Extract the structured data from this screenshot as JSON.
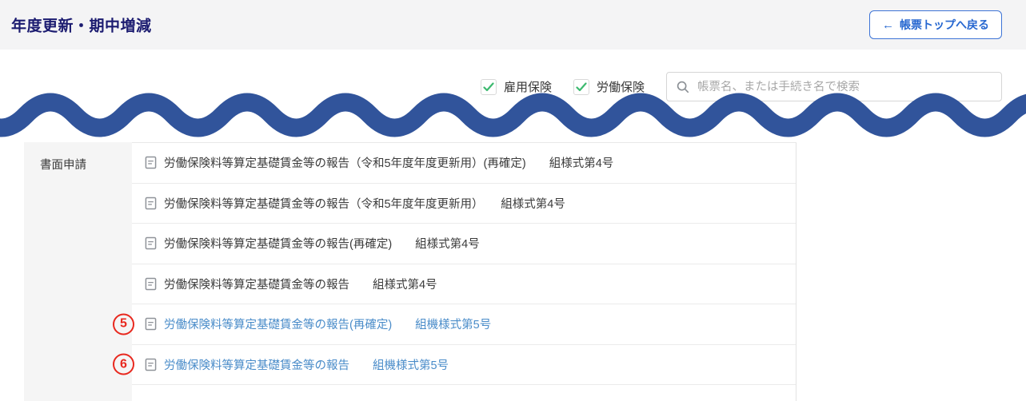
{
  "header": {
    "title": "年度更新・期中増減",
    "back_button_arrow": "←",
    "back_button_label": "帳票トップへ戻る"
  },
  "filters": {
    "checkboxes": [
      {
        "label": "雇用保険",
        "checked": true
      },
      {
        "label": "労働保険",
        "checked": true
      }
    ],
    "search_placeholder": "帳票名、または手続き名で検索"
  },
  "icons": {
    "back": "left-arrow",
    "search": "magnifier",
    "checkbox": "green-checkmark",
    "document": "document-sheet",
    "divider": "torn-edge-wave"
  },
  "colors": {
    "header_bg": "#f4f4f5",
    "title_navy": "#1b1b70",
    "accent_blue": "#2667d0",
    "wave_blue": "#31549b",
    "link_blue": "#4a8cc9",
    "annotation_red": "#e8281e",
    "check_green": "#3cb96f",
    "category_bg": "#f5f5f5"
  },
  "table": {
    "category": "書面申請",
    "rows": [
      {
        "annotation": "",
        "is_link": false,
        "label": "労働保険料等算定基礎賃金等の報告（令和5年度年度更新用）(再確定)　　組様式第4号"
      },
      {
        "annotation": "",
        "is_link": false,
        "label": "労働保険料等算定基礎賃金等の報告（令和5年度年度更新用）　　組様式第4号"
      },
      {
        "annotation": "",
        "is_link": false,
        "label": "労働保険料等算定基礎賃金等の報告(再確定)　　組様式第4号"
      },
      {
        "annotation": "",
        "is_link": false,
        "label": "労働保険料等算定基礎賃金等の報告　　組様式第4号"
      },
      {
        "annotation": "5",
        "is_link": true,
        "label": "労働保険料等算定基礎賃金等の報告(再確定)　　組機様式第5号"
      },
      {
        "annotation": "6",
        "is_link": true,
        "label": "労働保険料等算定基礎賃金等の報告　　組機様式第5号"
      }
    ]
  }
}
